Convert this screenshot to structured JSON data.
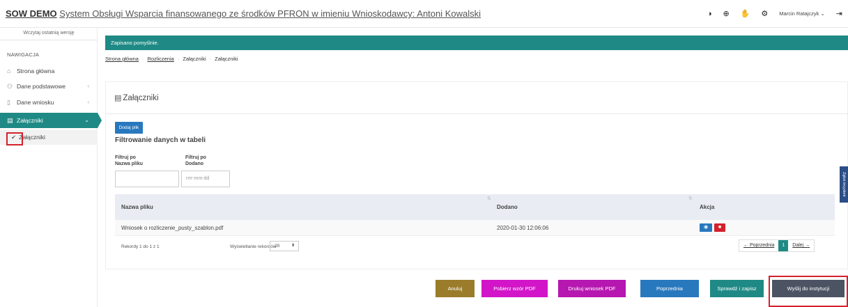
{
  "header": {
    "title_bold": "SOW DEMO",
    "title_rest": "System Obsługi Wsparcia finansowanego ze środków PFRON w imieniu Wnioskodawcy: Antoni Kowalski",
    "user_label": "Marcin Ratajczyk",
    "icons": [
      "contrast-icon",
      "zoom-icon",
      "sign-language-icon",
      "settings-icon",
      "user-chevron-icon",
      "logout-icon"
    ]
  },
  "sidebar": {
    "version_link": "Wczytaj ostatnią wersję",
    "nav_label": "NAWIGACJA",
    "items": [
      {
        "label": "Strona główna",
        "icon": "home-icon"
      },
      {
        "label": "Dane podstawowe",
        "icon": "users-icon"
      },
      {
        "label": "Dane wniosku",
        "icon": "file-icon"
      },
      {
        "label": "Załączniki",
        "icon": "document-icon"
      }
    ],
    "sub_item": {
      "label": "Załączniki",
      "icon": "check-icon"
    }
  },
  "alert": {
    "text": "Zapisano pomyślnie."
  },
  "breadcrumb": {
    "items": [
      "Strona główna",
      "Rozliczenia",
      "Załączniki",
      "Załączniki"
    ]
  },
  "panel": {
    "title": "Załączniki",
    "add_button": "Dodaj plik",
    "filter_title": "Filtrowanie danych w tabeli",
    "filter1_label_a": "Filtruj po",
    "filter1_label_b": "Nazwa pliku",
    "filter1_value": "",
    "filter2_label_a": "Filtruj po",
    "filter2_label_b": "Dodano",
    "filter2_placeholder": "rrrr-mm-dd",
    "columns": [
      "Nazwa pliku",
      "Dodano",
      "Akcja"
    ],
    "rows": [
      {
        "name": "Wniosek o rozliczenie_pusty_szablon.pdf",
        "added": "2020-01-30 12:06:06"
      }
    ],
    "records_text": "Rekordy 1 do 1 z 1",
    "perpage_label": "Wyświetlanie rekordów",
    "perpage_value": "20",
    "pager": {
      "prev": "← Poprzednia",
      "current": "1",
      "next": "Dalej →"
    }
  },
  "footer": {
    "buttons": [
      {
        "label": "Anuluj",
        "color": "#9b7c2a"
      },
      {
        "label": "Pobierz wzór PDF",
        "color": "#d215c8"
      },
      {
        "label": "Drukuj wniosek PDF",
        "color": "#b617b0"
      },
      {
        "label": "Poprzednia",
        "color": "#2878be"
      },
      {
        "label": "Sprawdź i zapisz",
        "color": "#1f8a85"
      },
      {
        "label": "Wyślij do instytucji",
        "color": "#4c5463"
      }
    ]
  },
  "feedback": {
    "label": "Zgłoś incydent"
  },
  "colors": {
    "teal": "#1f8a85",
    "blue": "#2878be",
    "red": "#d3212d"
  }
}
